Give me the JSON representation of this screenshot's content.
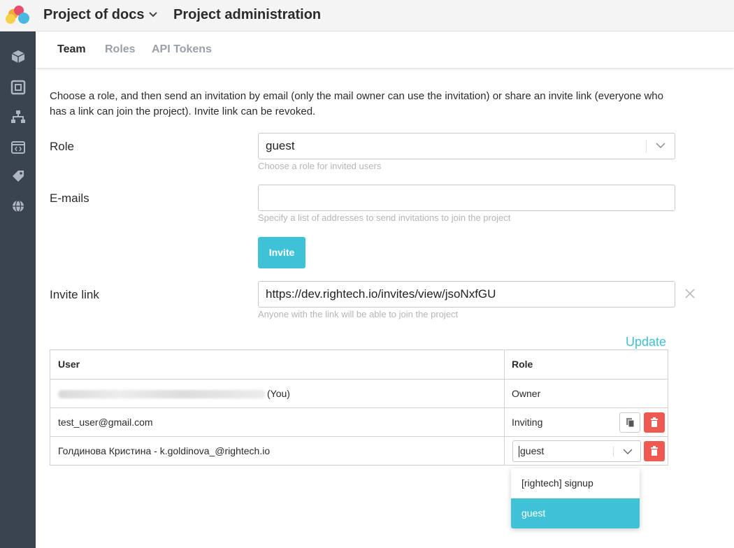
{
  "header": {
    "project_name": "Project of docs",
    "page_title": "Project administration"
  },
  "tabs": [
    {
      "label": "Team"
    },
    {
      "label": "Roles"
    },
    {
      "label": "API Tokens"
    }
  ],
  "intro_text": "Choose a role, and then send an invitation by email (only the mail owner can use the invitation) or share an invite link (everyone who has a link can join the project). Invite link can be revoked.",
  "role_field": {
    "label": "Role",
    "value": "guest",
    "hint": "Choose a role for invited users"
  },
  "emails_field": {
    "label": "E-mails",
    "value": "",
    "hint": "Specify a list of addresses to send invitations to join the project"
  },
  "invite_button": "Invite",
  "invite_link_field": {
    "label": "Invite link",
    "value": "https://dev.rightech.io/invites/view/jsoNxfGU",
    "hint": "Anyone with the link will be able to join the project"
  },
  "update_link": "Update",
  "table": {
    "headers": {
      "user": "User",
      "role": "Role"
    },
    "rows": [
      {
        "user_suffix": "(You)",
        "role": "Owner"
      },
      {
        "user": "test_user@gmail.com",
        "role": "Inviting"
      },
      {
        "user": "Голдинова Кристина - k.goldinova_@rightech.io",
        "role_select_value": "guest"
      }
    ]
  },
  "dropdown_options": [
    {
      "label": "[rightech] signup"
    },
    {
      "label": "guest",
      "selected": true
    }
  ],
  "colors": {
    "accent": "#3fc1d6",
    "danger": "#ee5a52",
    "sidebar": "#3a4350"
  }
}
